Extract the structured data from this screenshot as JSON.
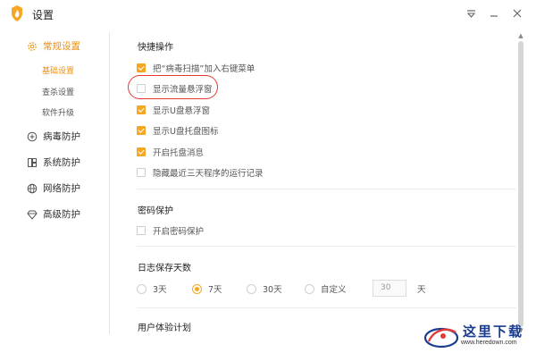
{
  "window": {
    "title": "设置"
  },
  "sidebar": {
    "items": [
      {
        "label": "常规设置",
        "icon": "gear-icon",
        "active": true
      },
      {
        "label": "病毒防护",
        "icon": "plus-circle-icon"
      },
      {
        "label": "系统防护",
        "icon": "grid-icon"
      },
      {
        "label": "网络防护",
        "icon": "globe-icon"
      },
      {
        "label": "高级防护",
        "icon": "diamond-icon"
      }
    ],
    "subitems": [
      {
        "label": "基础设置",
        "active": true
      },
      {
        "label": "查杀设置"
      },
      {
        "label": "软件升级"
      }
    ]
  },
  "quick_ops": {
    "title": "快捷操作",
    "options": [
      {
        "label": "把“病毒扫描”加入右键菜单",
        "checked": true
      },
      {
        "label": "显示流量悬浮窗",
        "checked": false
      },
      {
        "label": "显示U盘悬浮窗",
        "checked": true
      },
      {
        "label": "显示U盘托盘图标",
        "checked": true
      },
      {
        "label": "开启托盘消息",
        "checked": true
      },
      {
        "label": "隐藏最近三天程序的运行记录",
        "checked": false
      }
    ]
  },
  "password": {
    "title": "密码保护",
    "option": {
      "label": "开启密码保护",
      "checked": false
    }
  },
  "log": {
    "title": "日志保存天数",
    "options": [
      {
        "label": "3天",
        "selected": false
      },
      {
        "label": "7天",
        "selected": true
      },
      {
        "label": "30天",
        "selected": false
      },
      {
        "label": "自定义",
        "selected": false
      }
    ],
    "custom_value": "30",
    "unit": "天"
  },
  "ux": {
    "title": "用户体验计划"
  },
  "watermark": {
    "text": "这里下载",
    "url": "www.heredown.com"
  },
  "colors": {
    "accent": "#f5a623",
    "active_text": "#f0900d",
    "highlight": "#e53935"
  }
}
